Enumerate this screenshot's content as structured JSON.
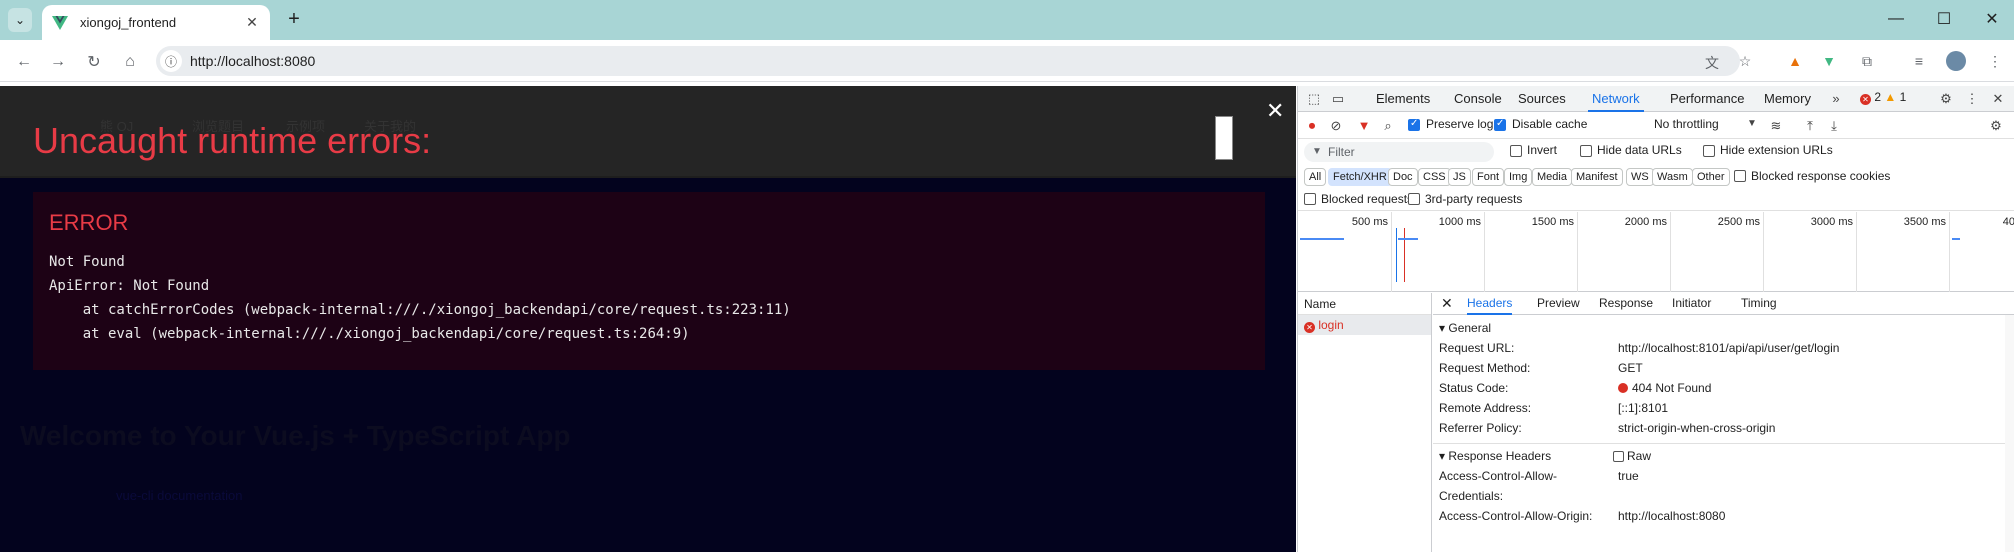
{
  "browser": {
    "tab_title": "xiongoj_frontend",
    "url": "http://localhost:8080"
  },
  "page": {
    "overlay_title": "Uncaught runtime errors:",
    "error_heading": "ERROR",
    "error_lines": [
      "Not Found",
      "ApiError: Not Found",
      "    at catchErrorCodes (webpack-internal:///./xiongoj_backendapi/core/request.ts:223:11)",
      "    at eval (webpack-internal:///./xiongoj_backendapi/core/request.ts:264:9)"
    ],
    "bg_nav": [
      "熊 OJ",
      "浏览题目",
      "示例项",
      "关于我的"
    ],
    "bg_heading": "Welcome to Your Vue.js + TypeScript App",
    "bg_link": "vue-cli documentation"
  },
  "devtools": {
    "tabs": [
      "Elements",
      "Console",
      "Sources",
      "Network",
      "Performance",
      "Memory"
    ],
    "active_tab": "Network",
    "error_count": "2",
    "warning_count": "1",
    "toolbar": {
      "preserve_log": "Preserve log",
      "disable_cache": "Disable cache",
      "throttling": "No throttling"
    },
    "filter_placeholder": "Filter",
    "filter_options": [
      "Invert",
      "Hide data URLs",
      "Hide extension URLs"
    ],
    "type_chips": [
      "All",
      "Fetch/XHR",
      "Doc",
      "CSS",
      "JS",
      "Font",
      "Img",
      "Media",
      "Manifest",
      "WS",
      "Wasm",
      "Other"
    ],
    "blocked_response_cookies": "Blocked response cookies",
    "blocked_requests": "Blocked requests",
    "third_party": "3rd-party requests",
    "timeline_labels": [
      "500 ms",
      "1000 ms",
      "1500 ms",
      "2000 ms",
      "2500 ms",
      "3000 ms",
      "3500 ms",
      "40"
    ],
    "list_header": "Name",
    "requests": [
      "login"
    ],
    "detail_tabs": [
      "Headers",
      "Preview",
      "Response",
      "Initiator",
      "Timing"
    ],
    "general": {
      "title": "General",
      "rows": [
        {
          "k": "Request URL:",
          "v": "http://localhost:8101/api/api/user/get/login"
        },
        {
          "k": "Request Method:",
          "v": "GET"
        },
        {
          "k": "Status Code:",
          "v": "404 Not Found"
        },
        {
          "k": "Remote Address:",
          "v": "[::1]:8101"
        },
        {
          "k": "Referrer Policy:",
          "v": "strict-origin-when-cross-origin"
        }
      ]
    },
    "response_headers": {
      "title": "Response Headers",
      "raw": "Raw",
      "rows": [
        {
          "k": "Access-Control-Allow-",
          "v": "true"
        },
        {
          "k": "Credentials:",
          "v": ""
        },
        {
          "k": "Access-Control-Allow-Origin:",
          "v": "http://localhost:8080"
        }
      ]
    }
  }
}
